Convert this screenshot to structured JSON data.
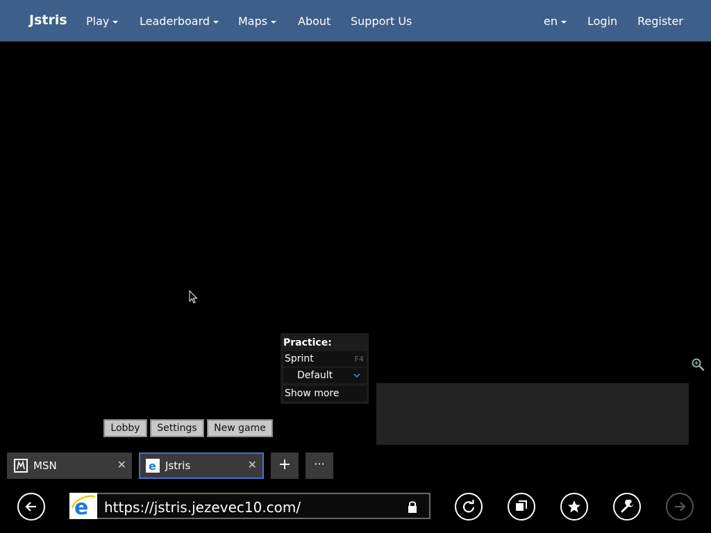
{
  "navbar": {
    "brand": "Jstris",
    "items": [
      {
        "label": "Play",
        "dropdown": true
      },
      {
        "label": "Leaderboard",
        "dropdown": true
      },
      {
        "label": "Maps",
        "dropdown": true
      },
      {
        "label": "About",
        "dropdown": false
      },
      {
        "label": "Support Us",
        "dropdown": false
      }
    ],
    "right_items": [
      {
        "label": "en",
        "dropdown": true
      },
      {
        "label": "Login",
        "dropdown": false
      },
      {
        "label": "Register",
        "dropdown": false
      }
    ],
    "bg_color": "#3d5f89"
  },
  "practice": {
    "title": "Practice:",
    "sprint_label": "Sprint",
    "sprint_hotkey": "F4",
    "mode_value": "Default",
    "show_more": "Show more"
  },
  "game_buttons": [
    "Lobby",
    "Settings",
    "New game"
  ],
  "browser": {
    "tabs": [
      {
        "label": "MSN",
        "icon": "msn-icon",
        "active": false
      },
      {
        "label": "Jstris",
        "icon": "ie-icon",
        "active": true
      }
    ],
    "new_tab_symbol": "+",
    "more_symbol": "···",
    "url": "https://jstris.jezevec10.com/",
    "accent_color": "#4b6cd8"
  }
}
